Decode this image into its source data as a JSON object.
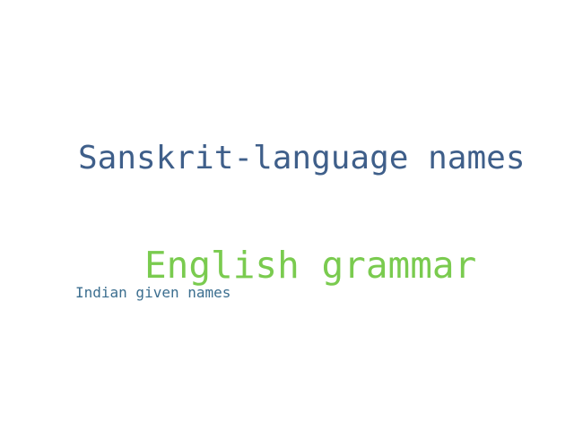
{
  "word_cloud": {
    "words": [
      {
        "text": "Sanskrit-language names",
        "color": "#3f5f8a"
      },
      {
        "text": "English grammar",
        "color": "#7acb4f"
      },
      {
        "text": "Indian given names",
        "color": "#3b6e8f"
      }
    ]
  }
}
